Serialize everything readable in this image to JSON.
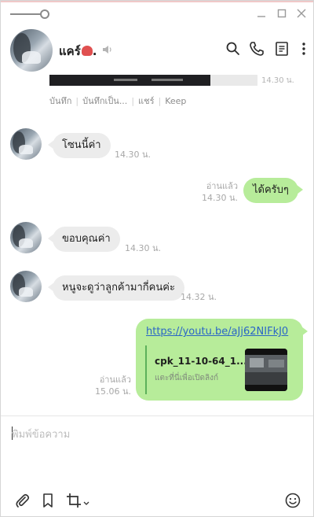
{
  "header": {
    "contact_name": "แคร์",
    "name_suffix": ".",
    "icons": [
      "search-icon",
      "phone-icon",
      "notes-icon",
      "more-icon"
    ]
  },
  "previous_message": {
    "time": "14.30 น.",
    "actions": [
      "บันทึก",
      "บันทึกเป็น...",
      "แชร์",
      "Keep"
    ]
  },
  "messages": [
    {
      "side": "in",
      "text": "โซนนี้ค่า",
      "time": "14.30 น."
    },
    {
      "side": "out",
      "text": "ได้ครับๆ",
      "read": "อ่านแล้ว",
      "time": "14.30 น."
    },
    {
      "side": "in",
      "text": "ขอบคุณค่า",
      "time": "14.30 น."
    },
    {
      "side": "in",
      "text": "หนูจะดูว่าลูกค้ามากี่คนค่ะ",
      "time": "14.32 น."
    }
  ],
  "link_message": {
    "url": "https://youtu.be/aJj62NIFkJ0",
    "preview_title": "cpk_11-10-64_1...",
    "preview_subtitle": "แตะที่นี่เพื่อเปิดลิงก์",
    "read": "อ่านแล้ว",
    "time": "15.06 น."
  },
  "composer": {
    "placeholder": "พิมพ์ข้อความ",
    "value": ""
  },
  "colors": {
    "outgoing_bubble": "#b7ec9a",
    "incoming_bubble": "#ececec",
    "link": "#2a66c6",
    "preview_border": "#5db15b"
  }
}
